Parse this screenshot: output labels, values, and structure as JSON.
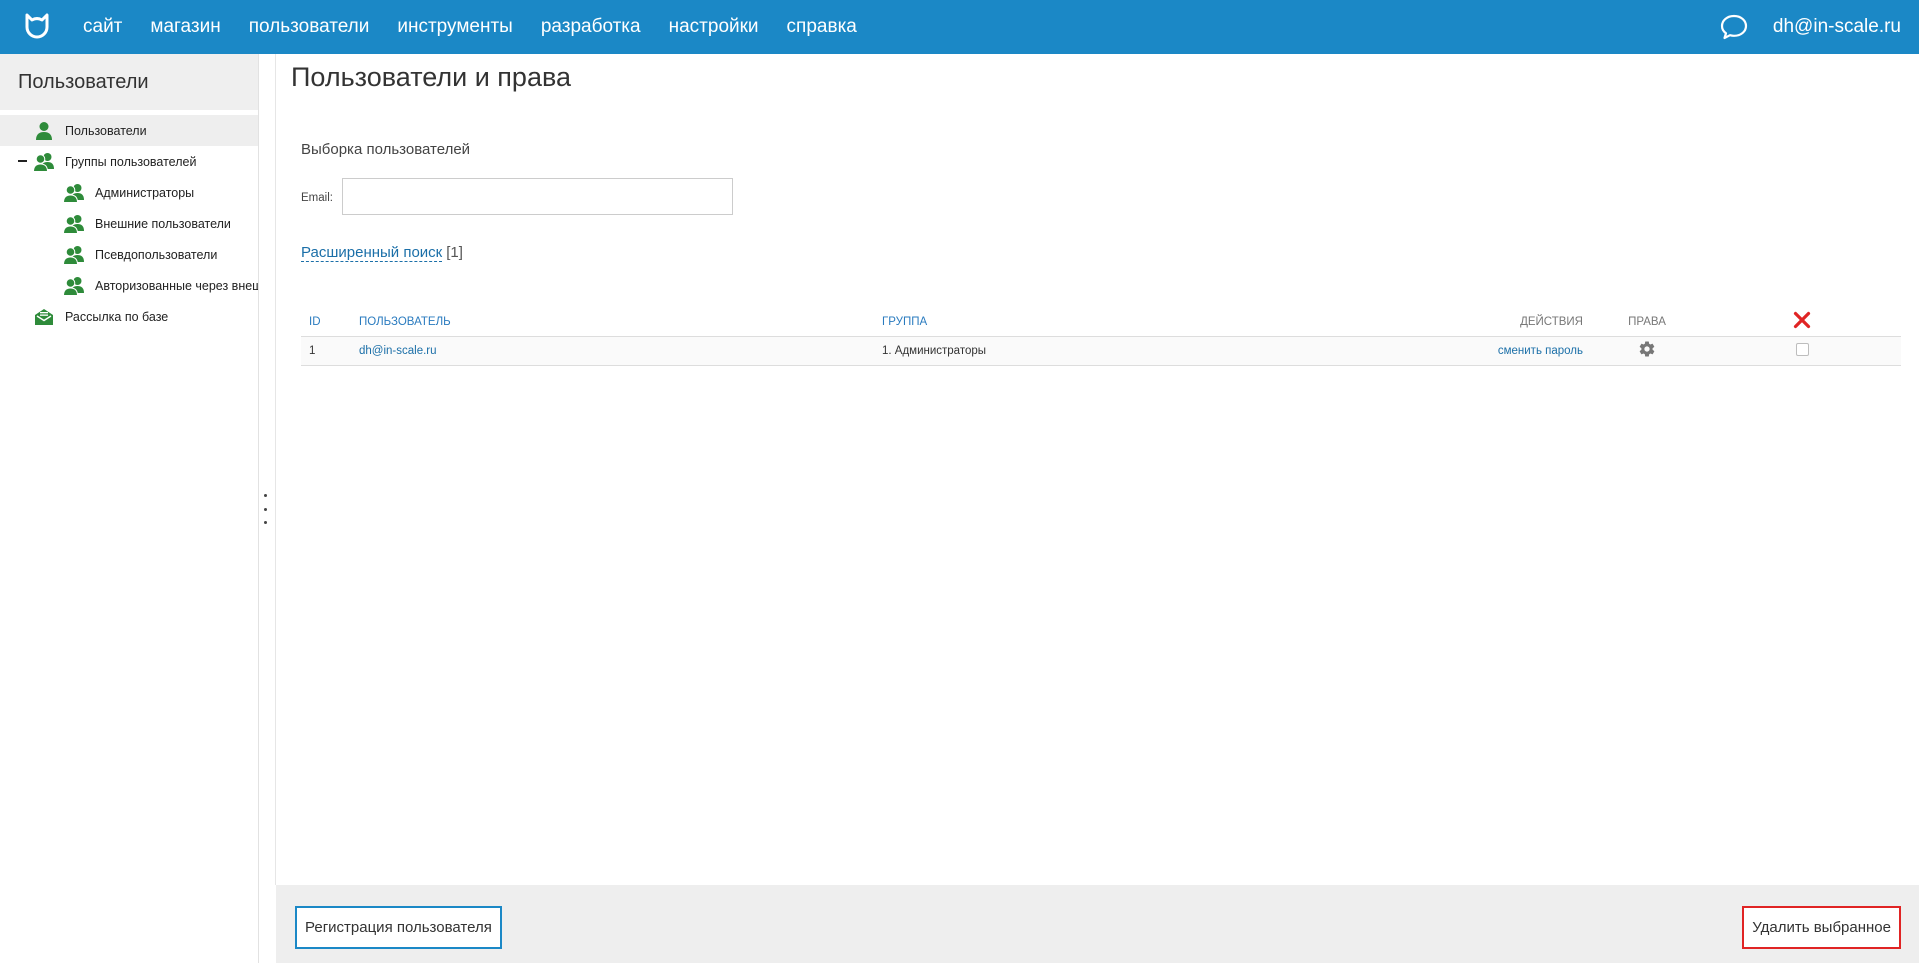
{
  "topbar": {
    "logo_icon": "cat-logo-icon",
    "nav": [
      {
        "label": "сайт"
      },
      {
        "label": "магазин"
      },
      {
        "label": "пользователи"
      },
      {
        "label": "инструменты"
      },
      {
        "label": "разработка"
      },
      {
        "label": "настройки"
      },
      {
        "label": "справка"
      }
    ],
    "chat_icon": "speech-bubble-icon",
    "user_email": "dh@in-scale.ru"
  },
  "sidebar": {
    "title": "Пользователи",
    "items": [
      {
        "label": "Пользователи",
        "icon": "user-icon",
        "active": true
      },
      {
        "label": "Группы пользователей",
        "icon": "users-group-icon",
        "expanded": true
      },
      {
        "label": "Администраторы",
        "icon": "users-group-icon"
      },
      {
        "label": "Внешние пользователи",
        "icon": "users-group-icon"
      },
      {
        "label": "Псевдопользователи",
        "icon": "users-group-icon"
      },
      {
        "label": "Авторизованные через внешние сервисы",
        "icon": "users-group-icon"
      },
      {
        "label": "Рассылка по базе",
        "icon": "mail-icon"
      }
    ]
  },
  "main": {
    "title": "Пользователи и права",
    "filter": {
      "title": "Выборка пользователей",
      "email_label": "Email:",
      "email_value": "",
      "advanced_search": "Расширенный поиск",
      "advanced_count": "[1]"
    },
    "table": {
      "headers": {
        "id": "ID",
        "user": "Пользователь",
        "group": "Группа",
        "actions": "Действия",
        "rights": "Права"
      },
      "rows": [
        {
          "id": "1",
          "user": "dh@in-scale.ru",
          "group": "1. Администраторы",
          "action": "сменить пароль",
          "checked": false
        }
      ]
    }
  },
  "bottom": {
    "register_label": "Регистрация пользователя",
    "delete_label": "Удалить выбранное"
  },
  "colors": {
    "topbar": "#1b88c6",
    "link": "#1b6fa8",
    "icon_green": "#2e8b3a",
    "delete_red": "#e02424"
  }
}
